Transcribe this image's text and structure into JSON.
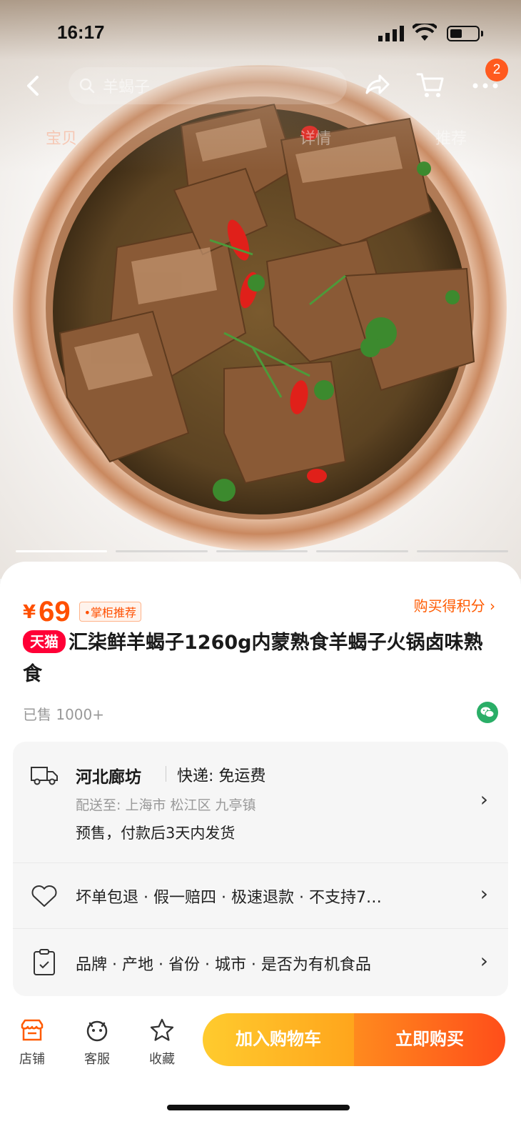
{
  "status_bar": {
    "time": "16:17"
  },
  "nav": {
    "search_text": "羊蝎子",
    "cart_badge": "2",
    "tabs": [
      "宝贝",
      "详情",
      "推荐"
    ]
  },
  "product": {
    "currency": "¥",
    "price": "69",
    "recommend_tag": "•掌柜推荐",
    "points_link": "购买得积分 ›",
    "platform_badge": "天猫",
    "title": "汇柒鲜羊蝎子1260g内蒙熟食羊蝎子火锅卤味熟食",
    "sold": "已售 1000+"
  },
  "delivery": {
    "origin": "河北廊坊",
    "shipping": "快递: 免运费",
    "destination": "配送至: 上海市 松江区 九亭镇",
    "presale": "预售，付款后3天内发货"
  },
  "services": {
    "text": "坏单包退 · 假一赔四 · 极速退款 · 不支持7…"
  },
  "params": {
    "text": "品牌 · 产地 · 省份 · 城市 · 是否为有机食品"
  },
  "bottom_bar": {
    "store": "店铺",
    "service": "客服",
    "favorite": "收藏",
    "add_to_cart": "加入购物车",
    "buy_now": "立即购买"
  },
  "colors": {
    "accent": "#ff4f00",
    "tmall": "#ff0036",
    "cart_btn": "#ffb020",
    "buy_btn": "#ff5a1a"
  },
  "hero": {
    "image_index": 1,
    "image_count": 5
  }
}
